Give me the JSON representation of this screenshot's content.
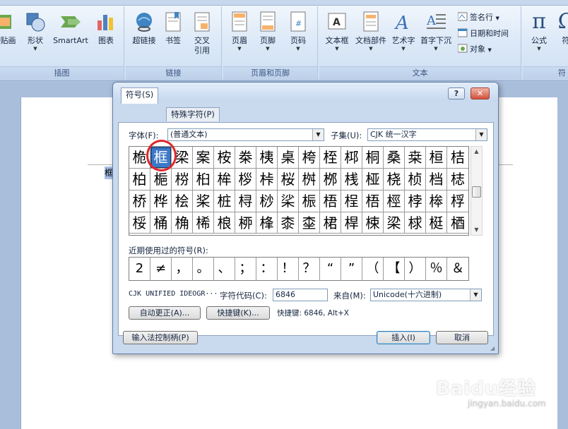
{
  "ribbon": {
    "groups": {
      "illustrations": {
        "label": "插图",
        "buttons": [
          "剪贴画",
          "形状",
          "SmartArt",
          "图表"
        ]
      },
      "links": {
        "label": "链接",
        "buttons": [
          "超链接",
          "书签",
          "交叉",
          "引用"
        ]
      },
      "header_footer": {
        "label": "页眉和页脚",
        "buttons": [
          "页眉",
          "页脚",
          "页码"
        ]
      },
      "text": {
        "label": "文本",
        "buttons": [
          "文本框",
          "文档部件",
          "艺术字",
          "首字下沉"
        ],
        "small_buttons": [
          "签名行",
          "日期和时间",
          "对象"
        ]
      },
      "symbols": {
        "label": "符",
        "buttons": [
          "公式",
          "符"
        ]
      }
    }
  },
  "document": {
    "char": "框"
  },
  "dialog": {
    "title": "符号",
    "help_button": "?",
    "close_button": "✕",
    "tabs": [
      "符号(S)",
      "特殊字符(P)"
    ],
    "font_label": "字体(F):",
    "font_value": "(普通文本)",
    "subset_label": "子集(U):",
    "subset_value": "CJK 统一汉字",
    "grid": [
      [
        "桅",
        "框",
        "梁",
        "案",
        "桉",
        "桊",
        "桋",
        "桌",
        "桍",
        "桎",
        "桏",
        "桐",
        "桑",
        "桒",
        "桓",
        "桔"
      ],
      [
        "柏",
        "梔",
        "梤",
        "桕",
        "桙",
        "桚",
        "桛",
        "桜",
        "桝",
        "桞",
        "桟",
        "桠",
        "桡",
        "桢",
        "档",
        "梽"
      ],
      [
        "桥",
        "桦",
        "桧",
        "桨",
        "桩",
        "桪",
        "桫",
        "桬",
        "桭",
        "梧",
        "桯",
        "梧",
        "桱",
        "桲",
        "桳",
        "桴"
      ],
      [
        "桵",
        "桶",
        "桷",
        "桸",
        "桹",
        "桺",
        "桻",
        "桼",
        "桽",
        "桾",
        "桿",
        "梀",
        "梁",
        "梂",
        "梃",
        "梄"
      ]
    ],
    "selected_index": 1,
    "recent_label": "近期使用过的符号(R):",
    "recent_symbols": [
      "2",
      "≠",
      "，",
      "。",
      "、",
      "；",
      "：",
      "！",
      "？",
      "“",
      "”",
      "（",
      "【",
      "）",
      "％",
      "＆"
    ],
    "char_name": "CJK UNIFIED IDEOGR···",
    "char_code_label": "字符代码(C):",
    "char_code_value": "6846",
    "from_label": "来自(M):",
    "from_value": "Unicode(十六进制)",
    "autocorrect_button": "自动更正(A)...",
    "shortcut_key_button": "快捷键(K)...",
    "shortcut_text": "快捷键: 6846, Alt+X",
    "ime_button": "输入法控制柄(P)",
    "insert_button": "插入(I)",
    "cancel_button": "取消"
  },
  "watermark": {
    "main": "Baidu经验",
    "sub": "jingyan.baidu.com"
  }
}
